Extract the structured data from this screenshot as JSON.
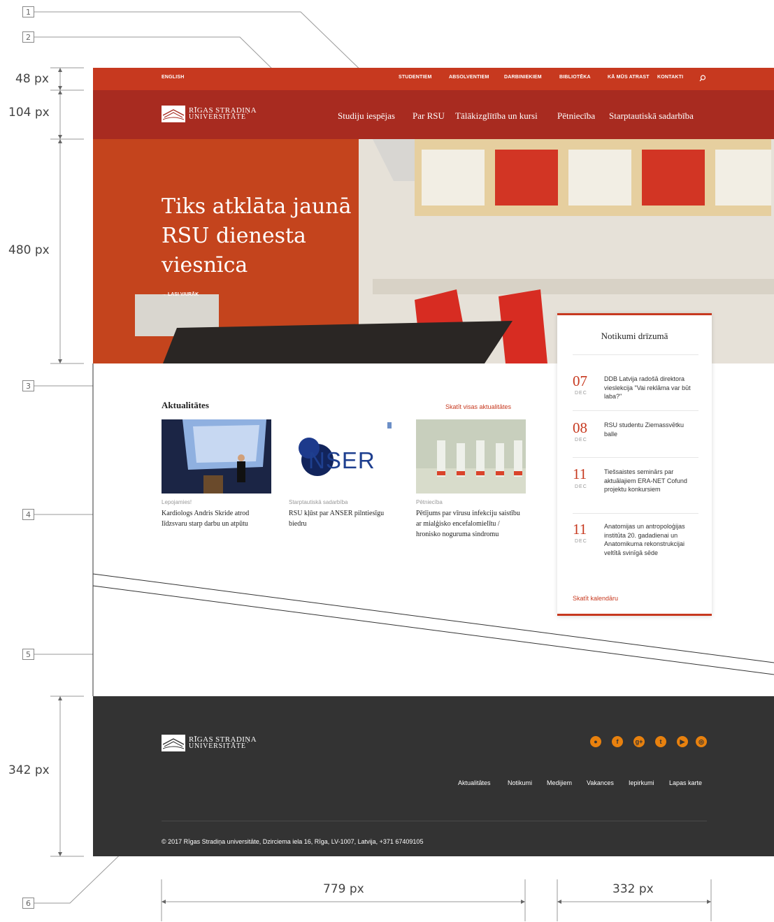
{
  "annotations": {
    "callouts": [
      "1",
      "2",
      "3",
      "4",
      "5",
      "6"
    ],
    "dims": {
      "topbar": "48 px",
      "nav": "104 px",
      "hero": "480 px",
      "footer": "342 px",
      "content_width": "779 px",
      "sidebar_width": "332 px"
    }
  },
  "topbar": {
    "language": "ENGLISH",
    "links": [
      "STUDENTIEM",
      "ABSOLVENTIEM",
      "DARBINIEKIEM",
      "BIBLIOTĒKA",
      "KĀ MŪS ATRAST",
      "KONTAKTI"
    ],
    "search_icon": "search-icon"
  },
  "logo": {
    "line1": "RĪGAS STRADIŅA",
    "line2": "UNIVERSITĀTE"
  },
  "mainnav": {
    "links": [
      "Studiju iespējas",
      "Par RSU",
      "Tālākizglītība un kursi",
      "Pētniecība",
      "Starptautiskā sadarbība"
    ]
  },
  "hero": {
    "title_line1": "Tiks atklāta jaunā",
    "title_line2": "RSU dienesta viesnīca",
    "more": "→  LASI VAIRĀK"
  },
  "news": {
    "heading": "Aktualitātes",
    "view_all": "Skatīt visas aktualitātes",
    "items": [
      {
        "category": "Lepojamies!",
        "title": "Kardiologs Andris Skride atrod līdzsvaru starp darbu un atpūtu"
      },
      {
        "category": "Starptautiskā sadarbība",
        "title": "RSU kļūst par ANSER pilntiesīgu biedru",
        "image_text": "NSER"
      },
      {
        "category": "Pētniecība",
        "title": "Pētījums par vīrusu infekciju saistību ar mialģisko encefalomielītu / hronisko noguruma sindromu"
      }
    ]
  },
  "events": {
    "heading": "Notikumi drīzumā",
    "items": [
      {
        "day": "07",
        "month": "DEC",
        "text": "DDB Latvija radošā direktora vieslekcija \"Vai reklāma var būt laba?\""
      },
      {
        "day": "08",
        "month": "DEC",
        "text": "RSU studentu Ziemassvētku balle"
      },
      {
        "day": "11",
        "month": "DEC",
        "text": "Tiešsaistes seminārs par aktuālajiem ERA-NET Cofund projektu konkursiem"
      },
      {
        "day": "11",
        "month": "DEC",
        "text": "Anatomijas un antropoloģijas institūta 20. gadadienai un Anatomikuma rekonstrukcijai veltītā svinīgā sēde"
      }
    ],
    "calendar_link": "Skatīt kalendāru"
  },
  "footer": {
    "social_icons": [
      "flickr-icon",
      "facebook-icon",
      "google-plus-icon",
      "twitter-icon",
      "youtube-icon",
      "instagram-icon"
    ],
    "links": [
      "Aktualitātes",
      "Notikumi",
      "Medijiem",
      "Vakances",
      "Iepirkumi",
      "Lapas karte"
    ],
    "copyright": "© 2017 Rīgas Stradiņa universitāte, Dzirciema iela 16, Rīga, LV-1007, Latvija, +371 67409105"
  },
  "colors": {
    "topbar": "#c7391f",
    "nav": "#a82b20",
    "footer": "#333333",
    "accent": "#c7391f",
    "social": "#e8810e"
  }
}
